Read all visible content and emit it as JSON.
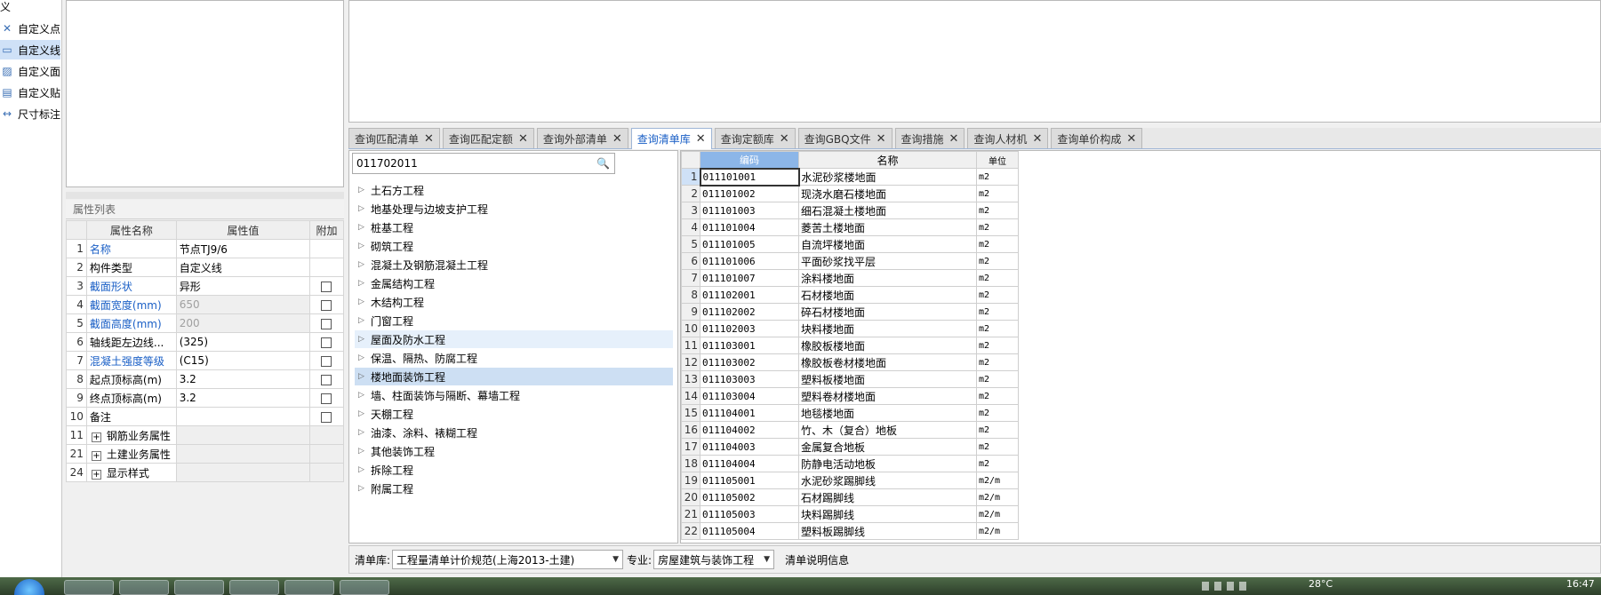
{
  "left_tools": [
    {
      "label": "义",
      "icon": "none"
    },
    {
      "label": "自定义点",
      "icon": "custom-point-icon"
    },
    {
      "label": "自定义线",
      "icon": "custom-line-icon",
      "selected": true
    },
    {
      "label": "自定义面",
      "icon": "custom-face-icon"
    },
    {
      "label": "自定义贴",
      "icon": "custom-paste-icon"
    },
    {
      "label": "尺寸标注",
      "icon": "dimension-icon"
    }
  ],
  "properties": {
    "title": "属性列表",
    "headers": {
      "name": "属性名称",
      "value": "属性值",
      "extra": "附加"
    },
    "rows": [
      {
        "num": "1",
        "name": "名称",
        "value": "节点TJ9/6",
        "blue": true,
        "checkbox": false,
        "disabled": false
      },
      {
        "num": "2",
        "name": "构件类型",
        "value": "自定义线",
        "blue": false,
        "checkbox": false,
        "disabled": false
      },
      {
        "num": "3",
        "name": "截面形状",
        "value": "异形",
        "blue": true,
        "checkbox": true,
        "disabled": false
      },
      {
        "num": "4",
        "name": "截面宽度(mm)",
        "value": "650",
        "blue": true,
        "checkbox": true,
        "disabled": true
      },
      {
        "num": "5",
        "name": "截面高度(mm)",
        "value": "200",
        "blue": true,
        "checkbox": true,
        "disabled": true
      },
      {
        "num": "6",
        "name": "轴线距左边线...",
        "value": "(325)",
        "blue": false,
        "checkbox": true,
        "disabled": false
      },
      {
        "num": "7",
        "name": "混凝土强度等级",
        "value": "(C15)",
        "blue": true,
        "checkbox": true,
        "disabled": false
      },
      {
        "num": "8",
        "name": "起点顶标高(m)",
        "value": "3.2",
        "blue": false,
        "checkbox": true,
        "disabled": false
      },
      {
        "num": "9",
        "name": "终点顶标高(m)",
        "value": "3.2",
        "blue": false,
        "checkbox": true,
        "disabled": false
      },
      {
        "num": "10",
        "name": "备注",
        "value": "",
        "blue": false,
        "checkbox": true,
        "disabled": false
      },
      {
        "num": "11",
        "name": "钢筋业务属性",
        "value": "",
        "group": true
      },
      {
        "num": "21",
        "name": "土建业务属性",
        "value": "",
        "group": true
      },
      {
        "num": "24",
        "name": "显示样式",
        "value": "",
        "group": true
      }
    ]
  },
  "tabs": [
    {
      "label": "查询匹配清单",
      "active": false
    },
    {
      "label": "查询匹配定额",
      "active": false
    },
    {
      "label": "查询外部清单",
      "active": false
    },
    {
      "label": "查询清单库",
      "active": true
    },
    {
      "label": "查询定额库",
      "active": false
    },
    {
      "label": "查询GBQ文件",
      "active": false
    },
    {
      "label": "查询措施",
      "active": false
    },
    {
      "label": "查询人材机",
      "active": false
    },
    {
      "label": "查询单价构成",
      "active": false
    }
  ],
  "search": {
    "value": "011702011"
  },
  "tree": [
    {
      "label": "土石方工程",
      "state": ""
    },
    {
      "label": "地基处理与边坡支护工程",
      "state": ""
    },
    {
      "label": "桩基工程",
      "state": ""
    },
    {
      "label": "砌筑工程",
      "state": ""
    },
    {
      "label": "混凝土及钢筋混凝土工程",
      "state": ""
    },
    {
      "label": "金属结构工程",
      "state": ""
    },
    {
      "label": "木结构工程",
      "state": ""
    },
    {
      "label": "门窗工程",
      "state": ""
    },
    {
      "label": "屋面及防水工程",
      "state": "hover"
    },
    {
      "label": "保温、隔热、防腐工程",
      "state": ""
    },
    {
      "label": "楼地面装饰工程",
      "state": "selected"
    },
    {
      "label": "墙、柱面装饰与隔断、幕墙工程",
      "state": ""
    },
    {
      "label": "天棚工程",
      "state": ""
    },
    {
      "label": "油漆、涂料、裱糊工程",
      "state": ""
    },
    {
      "label": "其他装饰工程",
      "state": ""
    },
    {
      "label": "拆除工程",
      "state": ""
    },
    {
      "label": "附属工程",
      "state": ""
    }
  ],
  "bill_table": {
    "headers": {
      "code": "编码",
      "name": "名称",
      "unit": "单位"
    },
    "rows": [
      {
        "n": "1",
        "code": "011101001",
        "name": "水泥砂浆楼地面",
        "unit": "m2"
      },
      {
        "n": "2",
        "code": "011101002",
        "name": "现浇水磨石楼地面",
        "unit": "m2"
      },
      {
        "n": "3",
        "code": "011101003",
        "name": "细石混凝土楼地面",
        "unit": "m2"
      },
      {
        "n": "4",
        "code": "011101004",
        "name": "菱苦土楼地面",
        "unit": "m2"
      },
      {
        "n": "5",
        "code": "011101005",
        "name": "自流坪楼地面",
        "unit": "m2"
      },
      {
        "n": "6",
        "code": "011101006",
        "name": "平面砂浆找平层",
        "unit": "m2"
      },
      {
        "n": "7",
        "code": "011101007",
        "name": "涂料楼地面",
        "unit": "m2"
      },
      {
        "n": "8",
        "code": "011102001",
        "name": "石材楼地面",
        "unit": "m2"
      },
      {
        "n": "9",
        "code": "011102002",
        "name": "碎石材楼地面",
        "unit": "m2"
      },
      {
        "n": "10",
        "code": "011102003",
        "name": "块料楼地面",
        "unit": "m2"
      },
      {
        "n": "11",
        "code": "011103001",
        "name": "橡胶板楼地面",
        "unit": "m2"
      },
      {
        "n": "12",
        "code": "011103002",
        "name": "橡胶板卷材楼地面",
        "unit": "m2"
      },
      {
        "n": "13",
        "code": "011103003",
        "name": "塑料板楼地面",
        "unit": "m2"
      },
      {
        "n": "14",
        "code": "011103004",
        "name": "塑料卷材楼地面",
        "unit": "m2"
      },
      {
        "n": "15",
        "code": "011104001",
        "name": "地毯楼地面",
        "unit": "m2"
      },
      {
        "n": "16",
        "code": "011104002",
        "name": "竹、木（复合）地板",
        "unit": "m2"
      },
      {
        "n": "17",
        "code": "011104003",
        "name": "金属复合地板",
        "unit": "m2"
      },
      {
        "n": "18",
        "code": "011104004",
        "name": "防静电活动地板",
        "unit": "m2"
      },
      {
        "n": "19",
        "code": "011105001",
        "name": "水泥砂浆踢脚线",
        "unit": "m2/m"
      },
      {
        "n": "20",
        "code": "011105002",
        "name": "石材踢脚线",
        "unit": "m2/m"
      },
      {
        "n": "21",
        "code": "011105003",
        "name": "块料踢脚线",
        "unit": "m2/m"
      },
      {
        "n": "22",
        "code": "011105004",
        "name": "塑料板踢脚线",
        "unit": "m2/m"
      }
    ]
  },
  "bottom": {
    "lib_label": "清单库:",
    "lib_value": "工程量清单计价规范(上海2013-土建)",
    "spec_label": "专业:",
    "spec_value": "房屋建筑与装饰工程",
    "info_label": "清单说明信息"
  },
  "taskbar": {
    "temp": "28°C",
    "time": "16:47"
  }
}
